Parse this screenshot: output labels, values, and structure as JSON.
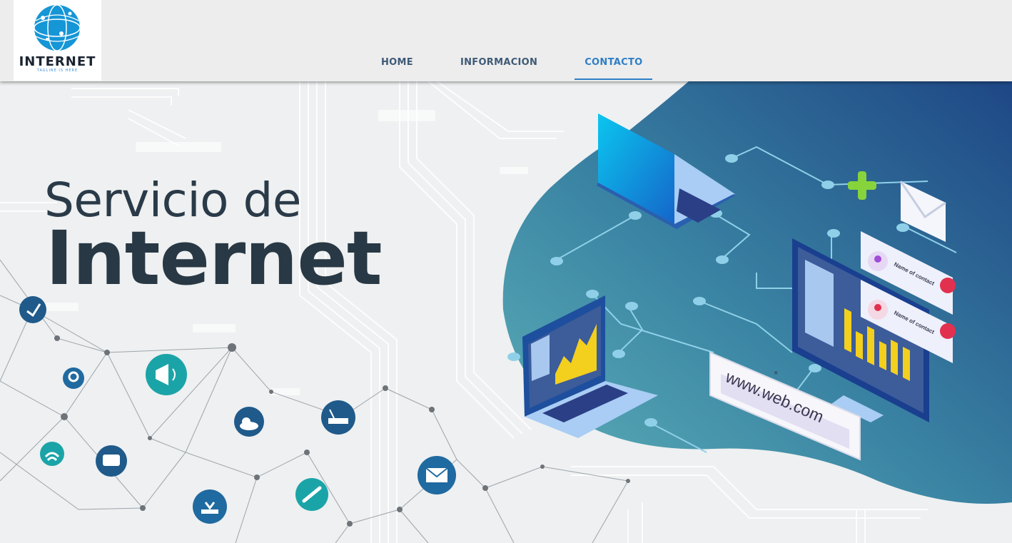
{
  "logo": {
    "name": "INTERNET",
    "tagline": "TAGLINE IS HERE"
  },
  "nav": {
    "items": [
      {
        "label": "HOME",
        "active": false
      },
      {
        "label": "INFORMACION",
        "active": false
      },
      {
        "label": "CONTACTO",
        "active": true
      }
    ]
  },
  "hero": {
    "title_line1": "Servicio de",
    "title_line2": "Internet",
    "url_text": "www.web.com",
    "contact_card_title": "Name of contact"
  },
  "colors": {
    "nav_text": "#3e5a76",
    "nav_active": "#2f7ec6",
    "title": "#283844",
    "blob_dark": "#1f4a8a",
    "blob_teal": "#4fa3b0"
  },
  "icons": [
    "network-share-icon",
    "chat-pin-icon",
    "megaphone-icon",
    "wifi-icon",
    "chat-bubble-icon",
    "cloud-upload-icon",
    "router-icon",
    "download-icon",
    "wrench-icon",
    "email-icon"
  ]
}
